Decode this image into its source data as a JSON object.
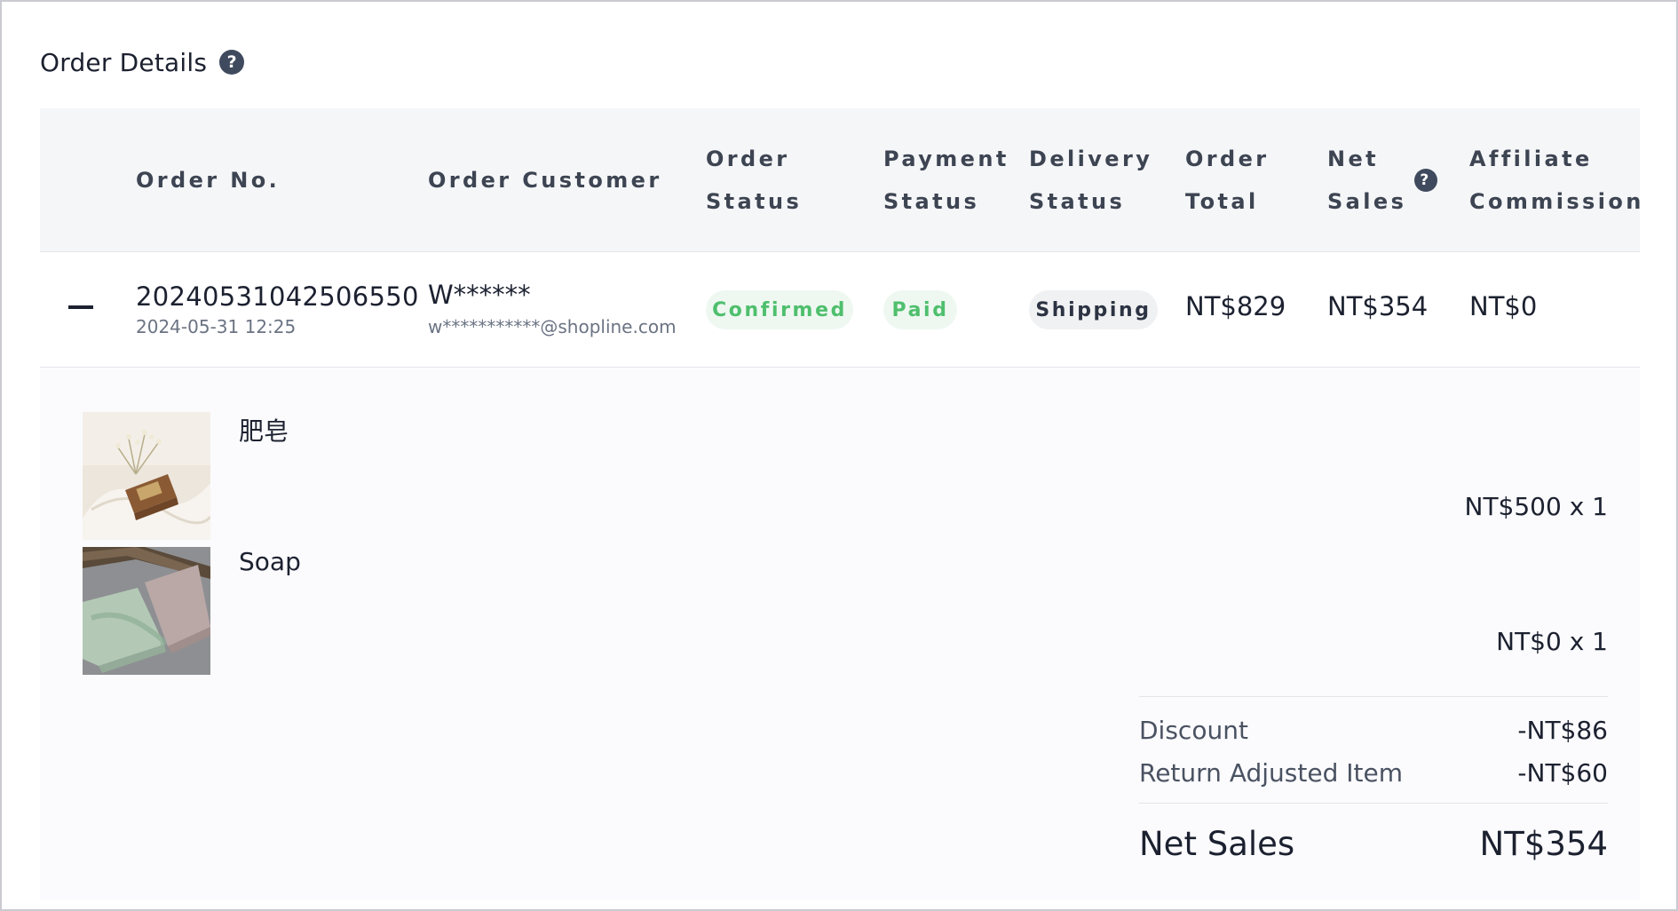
{
  "section": {
    "title": "Order Details",
    "help_icon": "question-circle-icon"
  },
  "table": {
    "columns": [
      {
        "key": "order_no",
        "label": "Order No."
      },
      {
        "key": "order_customer",
        "label": "Order Customer"
      },
      {
        "key": "order_status",
        "label": "Order\nStatus"
      },
      {
        "key": "payment_status",
        "label": "Payment\nStatus"
      },
      {
        "key": "delivery_status",
        "label": "Delivery\nStatus"
      },
      {
        "key": "order_total",
        "label": "Order\nTotal"
      },
      {
        "key": "net_sales",
        "label": "Net\nSales",
        "help_icon": "question-circle-icon"
      },
      {
        "key": "affiliate_commission",
        "label": "Affiliate\nCommission"
      }
    ],
    "rows": [
      {
        "expanded": true,
        "toggle_icon": "minus-icon",
        "order_no": "20240531042506550",
        "order_date": "2024-05-31 12:25",
        "customer_name": "W******",
        "customer_email": "w***********@shopline.com",
        "order_status": "Confirmed",
        "payment_status": "Paid",
        "delivery_status": "Shipping",
        "order_total": "NT$829",
        "net_sales": "NT$354",
        "affiliate_commission": "NT$0"
      }
    ]
  },
  "order_detail": {
    "items": [
      {
        "name": "肥皂",
        "price_qty": "NT$500 x 1",
        "image": "soap-product-photo"
      },
      {
        "name": "Soap",
        "price_qty": "NT$0 x 1",
        "image": "soap-bars-photo"
      }
    ],
    "summary": {
      "discount_label": "Discount",
      "discount_value": "-NT$86",
      "return_label": "Return Adjusted Item",
      "return_value": "-NT$60",
      "net_sales_label": "Net Sales",
      "net_sales_value": "NT$354"
    }
  },
  "colors": {
    "accent_green": "#4fbf6d",
    "badge_green_bg": "#eef8f1",
    "header_bg": "#f5f6f8",
    "text_primary": "#1c2130"
  }
}
